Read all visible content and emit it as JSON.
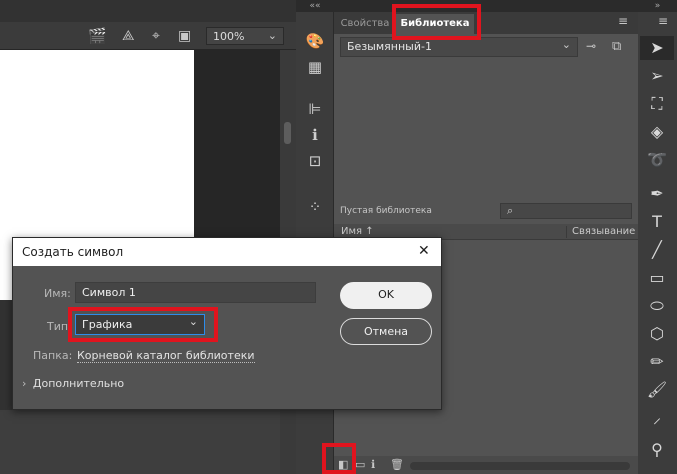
{
  "stage_toolbar": {
    "zoom_value": "100%"
  },
  "properties_panel": {
    "tabs": [
      "Свойства",
      "Библиотека"
    ],
    "library_select": "Безымянный-1",
    "empty_label": "Пустая библиотека",
    "columns": {
      "name": "Имя",
      "linkage": "Связывание"
    }
  },
  "dialog": {
    "title": "Создать символ",
    "name_label": "Имя:",
    "name_value": "Символ 1",
    "type_label": "Тип:",
    "type_value": "Графика",
    "folder_label": "Папка:",
    "folder_value": "Корневой каталог библиотеки",
    "advanced_label": "Дополнительно",
    "ok_label": "OK",
    "cancel_label": "Отмена",
    "close_glyph": "✕"
  },
  "colors": {
    "highlight": "#e0141e",
    "panel_bg": "#535353",
    "dialog_bg": "#535353",
    "accent_input": "#2d8ceb"
  }
}
